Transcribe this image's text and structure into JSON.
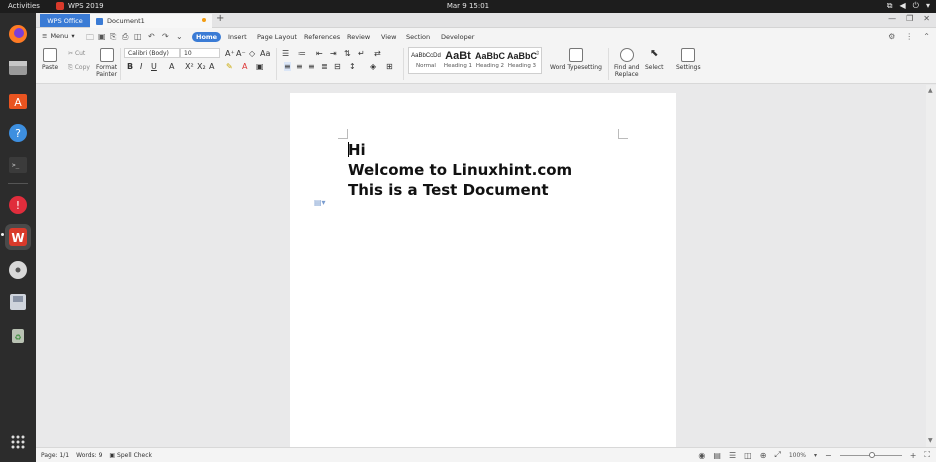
{
  "system": {
    "activities": "Activities",
    "app_name": "WPS 2019",
    "clock": "Mar 9  15:01",
    "tray_icons": [
      "network-icon",
      "volume-icon",
      "power-icon"
    ]
  },
  "dock": {
    "items": [
      {
        "name": "firefox",
        "glyph": "🦊"
      },
      {
        "name": "files",
        "glyph": "▭"
      },
      {
        "name": "software",
        "glyph": "A"
      },
      {
        "name": "help",
        "glyph": "?"
      },
      {
        "name": "terminal",
        "glyph": ">_"
      },
      {
        "name": "update",
        "glyph": "!"
      },
      {
        "name": "wps",
        "glyph": "W"
      },
      {
        "name": "disc",
        "glyph": "◉"
      },
      {
        "name": "drive",
        "glyph": "▤"
      },
      {
        "name": "trash",
        "glyph": "♻"
      }
    ],
    "apps_grid": "⋮⋮⋮"
  },
  "tabs": {
    "wps_office": "WPS Office",
    "document": "Document1",
    "new_tab": "+"
  },
  "menu": {
    "menu_label": "Menu",
    "ribbon_tabs": [
      "Home",
      "Insert",
      "Page Layout",
      "References",
      "Review",
      "View",
      "Section",
      "Developer"
    ]
  },
  "ribbon": {
    "paste": "Paste",
    "cut": "Cut",
    "copy": "Copy",
    "format_painter_1": "Format",
    "format_painter_2": "Painter",
    "font_name": "Calibri (Body)",
    "font_size": "10",
    "styles": [
      {
        "sample": "AaBbCcDd",
        "label": "Normal"
      },
      {
        "sample": "AaBt",
        "label": "Heading 1"
      },
      {
        "sample": "AaBbC",
        "label": "Heading 2"
      },
      {
        "sample": "AaBbC",
        "label": "Heading 3"
      }
    ],
    "word_typesetting": "Word Typesetting",
    "find_replace_1": "Find and",
    "find_replace_2": "Replace",
    "select": "Select",
    "settings": "Settings"
  },
  "document": {
    "lines": [
      "Hi",
      "Welcome to Linuxhint.com",
      "This is a Test Document"
    ]
  },
  "status": {
    "page": "Page: 1/1",
    "words": "Words: 9",
    "spell_check": "Spell Check",
    "zoom": "100%"
  }
}
